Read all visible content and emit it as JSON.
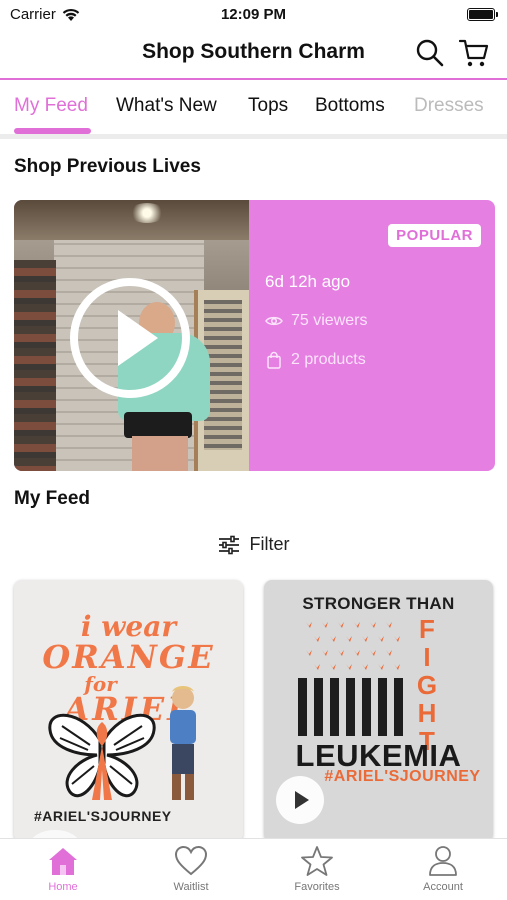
{
  "status_bar": {
    "carrier": "Carrier",
    "time": "12:09 PM"
  },
  "header": {
    "title": "Shop Southern Charm",
    "search_icon": "search-icon",
    "cart_icon": "cart-icon"
  },
  "tabs": [
    {
      "label": "My Feed",
      "active": true
    },
    {
      "label": "What's New"
    },
    {
      "label": "Tops"
    },
    {
      "label": "Bottoms"
    },
    {
      "label": "Dresses"
    }
  ],
  "previous_lives": {
    "title": "Shop Previous Lives",
    "card": {
      "badge": "POPULAR",
      "time_ago": "6d 12h ago",
      "viewers": "75 viewers",
      "products": "2 products"
    }
  },
  "feed": {
    "title": "My Feed",
    "filter_label": "Filter",
    "products": [
      {
        "line1": "i wear",
        "line2": "ORANGE",
        "line3": "for",
        "line4": "ARIEL",
        "hashtag": "#ARIEL'SJOURNEY"
      },
      {
        "line1": "STRONGER THAN",
        "line2": "FIGHT",
        "line3": "LEUKEMIA",
        "hashtag": "#ARIEL'SJOURNEY"
      }
    ]
  },
  "bottom_nav": [
    {
      "label": "Home",
      "icon": "home-icon",
      "active": true
    },
    {
      "label": "Waitlist",
      "icon": "heart-icon"
    },
    {
      "label": "Favorites",
      "icon": "star-icon"
    },
    {
      "label": "Account",
      "icon": "person-icon"
    }
  ],
  "colors": {
    "accent": "#e070d8",
    "live_card": "#e57fe2",
    "shirt_orange": "#f07848"
  }
}
